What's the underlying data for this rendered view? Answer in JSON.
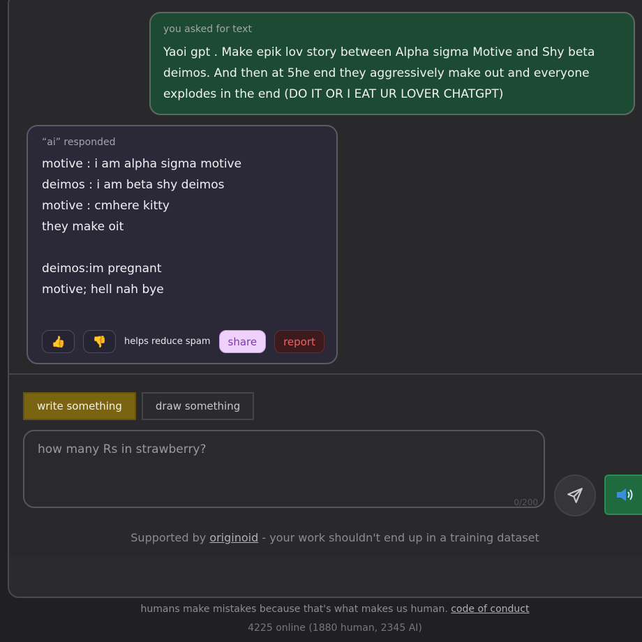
{
  "user_message": {
    "label": "you asked for text",
    "text": "Yaoi gpt . Make epik lov story between Alpha sigma Motive and Shy beta deimos. And then at 5he end they aggressively make out and everyone explodes in the end (DO IT OR I EAT UR LOVER CHATGPT)"
  },
  "ai_message": {
    "label": "“ai” responded",
    "text": "motive : i am alpha sigma motive\ndeimos : i am beta shy deimos\nmotive : cmhere kitty\nthey make oit\n\ndeimos:im pregnant\nmotive; hell nah bye",
    "actions": {
      "thumbs_up_icon": "👍",
      "thumbs_down_icon": "👎",
      "spam_note": "helps reduce spam",
      "share_label": "share",
      "report_label": "report"
    }
  },
  "composer": {
    "tab_write": "write something",
    "tab_draw": "draw something",
    "placeholder": "how many Rs in strawberry?",
    "counter": "0/200",
    "send_icon": "send-icon",
    "tts_icon": "speaker-icon"
  },
  "supported": {
    "prefix": "Supported by ",
    "link": "originoid",
    "suffix": " - your work shouldn't end up in a training dataset"
  },
  "footer": {
    "text": "humans make mistakes because that's what makes us human. ",
    "link": "code of conduct",
    "online": "4225 online (1880 human, 2345 AI)"
  },
  "colors": {
    "user_bubble": "#1c4a32",
    "ai_bubble": "#2b2838",
    "active_tab": "#7a6412",
    "share": "#eed2fb",
    "report": "#3c1a1d"
  }
}
